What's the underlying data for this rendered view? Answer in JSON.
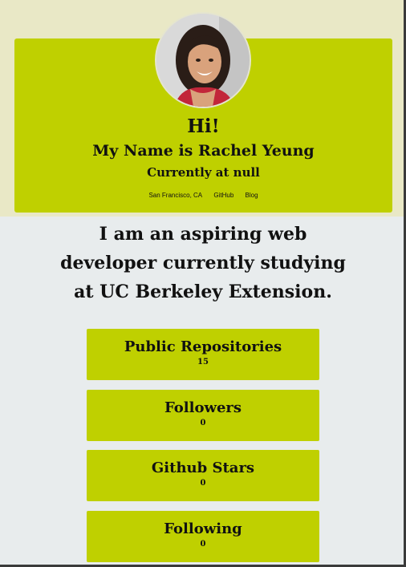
{
  "header": {
    "greeting": "Hi!",
    "name_line": "My Name is Rachel Yeung",
    "company_line": "Currently at null",
    "links": {
      "location": "San Francisco, CA",
      "github": "GitHub",
      "blog": "Blog"
    }
  },
  "bio": "I am an aspiring web developer currently studying at UC Berkeley Extension.",
  "stats": [
    {
      "title": "Public Repositories",
      "value": "15"
    },
    {
      "title": "Followers",
      "value": "0"
    },
    {
      "title": "Github Stars",
      "value": "0"
    },
    {
      "title": "Following",
      "value": "0"
    }
  ],
  "colors": {
    "accent": "#bfd000",
    "top_band": "#e9e8c6",
    "background": "#e8eced"
  }
}
